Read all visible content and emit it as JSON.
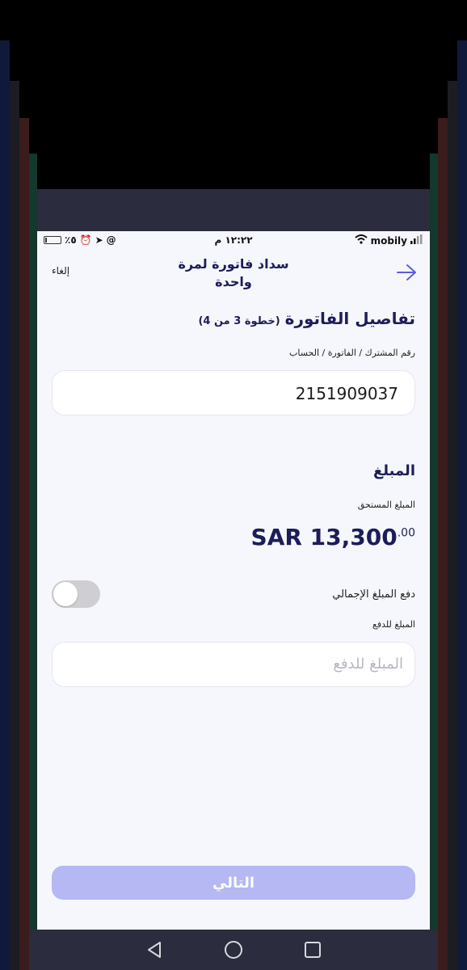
{
  "status_bar": {
    "battery": "٪٥",
    "time": "١٢:٢٢ م",
    "carrier": "mobily"
  },
  "header": {
    "cancel_label": "إلغاء",
    "title": "سداد فاتورة لمرة واحدة"
  },
  "section": {
    "title": "تفاصيل الفاتورة",
    "step": "(خطوة 3 من 4)"
  },
  "account": {
    "label": "رقم المشترك / الفاتورة / الحساب",
    "value": "2151909037"
  },
  "amount": {
    "title": "المبلغ",
    "due_label": "المبلغ المستحق",
    "due_value": "SAR 13,300",
    "due_decimals": ".00",
    "pay_total_label": "دفع المبلغ الإجمالي",
    "pay_total_on": false,
    "pay_amount_label": "المبلغ للدفع",
    "pay_amount_placeholder": "المبلغ للدفع"
  },
  "footer": {
    "next_label": "التالي"
  },
  "colors": {
    "primary": "#1d1d5a",
    "accent": "#5b5fe0",
    "button_disabled": "#b5b8f3"
  }
}
